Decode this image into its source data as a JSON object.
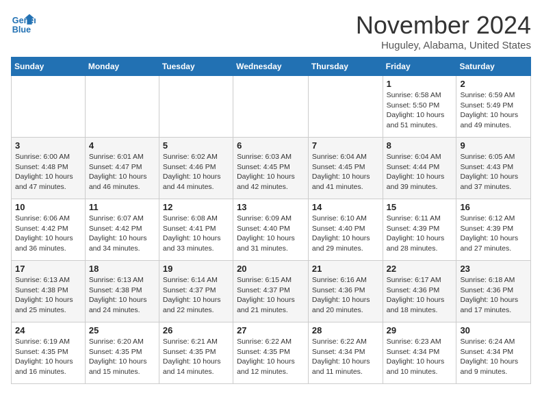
{
  "header": {
    "logo_line1": "General",
    "logo_line2": "Blue",
    "month_title": "November 2024",
    "location": "Huguley, Alabama, United States"
  },
  "weekdays": [
    "Sunday",
    "Monday",
    "Tuesday",
    "Wednesday",
    "Thursday",
    "Friday",
    "Saturday"
  ],
  "weeks": [
    [
      {
        "day": "",
        "content": ""
      },
      {
        "day": "",
        "content": ""
      },
      {
        "day": "",
        "content": ""
      },
      {
        "day": "",
        "content": ""
      },
      {
        "day": "",
        "content": ""
      },
      {
        "day": "1",
        "content": "Sunrise: 6:58 AM\nSunset: 5:50 PM\nDaylight: 10 hours\nand 51 minutes."
      },
      {
        "day": "2",
        "content": "Sunrise: 6:59 AM\nSunset: 5:49 PM\nDaylight: 10 hours\nand 49 minutes."
      }
    ],
    [
      {
        "day": "3",
        "content": "Sunrise: 6:00 AM\nSunset: 4:48 PM\nDaylight: 10 hours\nand 47 minutes."
      },
      {
        "day": "4",
        "content": "Sunrise: 6:01 AM\nSunset: 4:47 PM\nDaylight: 10 hours\nand 46 minutes."
      },
      {
        "day": "5",
        "content": "Sunrise: 6:02 AM\nSunset: 4:46 PM\nDaylight: 10 hours\nand 44 minutes."
      },
      {
        "day": "6",
        "content": "Sunrise: 6:03 AM\nSunset: 4:45 PM\nDaylight: 10 hours\nand 42 minutes."
      },
      {
        "day": "7",
        "content": "Sunrise: 6:04 AM\nSunset: 4:45 PM\nDaylight: 10 hours\nand 41 minutes."
      },
      {
        "day": "8",
        "content": "Sunrise: 6:04 AM\nSunset: 4:44 PM\nDaylight: 10 hours\nand 39 minutes."
      },
      {
        "day": "9",
        "content": "Sunrise: 6:05 AM\nSunset: 4:43 PM\nDaylight: 10 hours\nand 37 minutes."
      }
    ],
    [
      {
        "day": "10",
        "content": "Sunrise: 6:06 AM\nSunset: 4:42 PM\nDaylight: 10 hours\nand 36 minutes."
      },
      {
        "day": "11",
        "content": "Sunrise: 6:07 AM\nSunset: 4:42 PM\nDaylight: 10 hours\nand 34 minutes."
      },
      {
        "day": "12",
        "content": "Sunrise: 6:08 AM\nSunset: 4:41 PM\nDaylight: 10 hours\nand 33 minutes."
      },
      {
        "day": "13",
        "content": "Sunrise: 6:09 AM\nSunset: 4:40 PM\nDaylight: 10 hours\nand 31 minutes."
      },
      {
        "day": "14",
        "content": "Sunrise: 6:10 AM\nSunset: 4:40 PM\nDaylight: 10 hours\nand 29 minutes."
      },
      {
        "day": "15",
        "content": "Sunrise: 6:11 AM\nSunset: 4:39 PM\nDaylight: 10 hours\nand 28 minutes."
      },
      {
        "day": "16",
        "content": "Sunrise: 6:12 AM\nSunset: 4:39 PM\nDaylight: 10 hours\nand 27 minutes."
      }
    ],
    [
      {
        "day": "17",
        "content": "Sunrise: 6:13 AM\nSunset: 4:38 PM\nDaylight: 10 hours\nand 25 minutes."
      },
      {
        "day": "18",
        "content": "Sunrise: 6:13 AM\nSunset: 4:38 PM\nDaylight: 10 hours\nand 24 minutes."
      },
      {
        "day": "19",
        "content": "Sunrise: 6:14 AM\nSunset: 4:37 PM\nDaylight: 10 hours\nand 22 minutes."
      },
      {
        "day": "20",
        "content": "Sunrise: 6:15 AM\nSunset: 4:37 PM\nDaylight: 10 hours\nand 21 minutes."
      },
      {
        "day": "21",
        "content": "Sunrise: 6:16 AM\nSunset: 4:36 PM\nDaylight: 10 hours\nand 20 minutes."
      },
      {
        "day": "22",
        "content": "Sunrise: 6:17 AM\nSunset: 4:36 PM\nDaylight: 10 hours\nand 18 minutes."
      },
      {
        "day": "23",
        "content": "Sunrise: 6:18 AM\nSunset: 4:36 PM\nDaylight: 10 hours\nand 17 minutes."
      }
    ],
    [
      {
        "day": "24",
        "content": "Sunrise: 6:19 AM\nSunset: 4:35 PM\nDaylight: 10 hours\nand 16 minutes."
      },
      {
        "day": "25",
        "content": "Sunrise: 6:20 AM\nSunset: 4:35 PM\nDaylight: 10 hours\nand 15 minutes."
      },
      {
        "day": "26",
        "content": "Sunrise: 6:21 AM\nSunset: 4:35 PM\nDaylight: 10 hours\nand 14 minutes."
      },
      {
        "day": "27",
        "content": "Sunrise: 6:22 AM\nSunset: 4:35 PM\nDaylight: 10 hours\nand 12 minutes."
      },
      {
        "day": "28",
        "content": "Sunrise: 6:22 AM\nSunset: 4:34 PM\nDaylight: 10 hours\nand 11 minutes."
      },
      {
        "day": "29",
        "content": "Sunrise: 6:23 AM\nSunset: 4:34 PM\nDaylight: 10 hours\nand 10 minutes."
      },
      {
        "day": "30",
        "content": "Sunrise: 6:24 AM\nSunset: 4:34 PM\nDaylight: 10 hours\nand 9 minutes."
      }
    ]
  ]
}
